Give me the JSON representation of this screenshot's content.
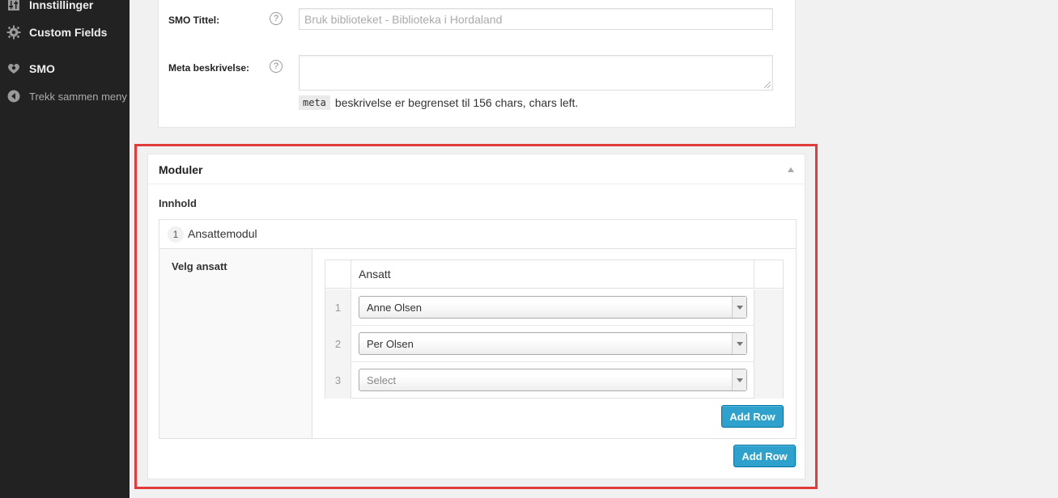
{
  "sidebar": {
    "items": [
      {
        "label": "Innstillinger",
        "icon": "settings-sliders-icon"
      },
      {
        "label": "Custom Fields",
        "icon": "gear-icon"
      },
      {
        "label": "SMO",
        "icon": "smo-icon"
      },
      {
        "label": "Trekk sammen meny",
        "icon": "collapse-menu-icon"
      }
    ]
  },
  "smo": {
    "title_label": "SMO Tittel:",
    "title_placeholder": "Bruk biblioteket  - Biblioteka i Hordaland",
    "desc_label": "Meta beskrivelse:",
    "help_glyph": "?",
    "meta_code": "meta",
    "meta_note": "beskrivelse er begrenset til 156 chars, chars left."
  },
  "moduler": {
    "title": "Moduler",
    "innhold_label": "Innhold",
    "layout": {
      "number": "1",
      "name": "Ansattemodul",
      "field_label": "Velg ansatt",
      "column_header": "Ansatt",
      "rows": [
        {
          "num": "1",
          "value": "Anne Olsen"
        },
        {
          "num": "2",
          "value": "Per Olsen"
        },
        {
          "num": "3",
          "value": "Select"
        }
      ],
      "add_row_label": "Add Row"
    },
    "add_row_label": "Add Row"
  },
  "colors": {
    "highlight": "#e23b3b",
    "button": "#2ea2cc",
    "sidebar": "#222222"
  }
}
